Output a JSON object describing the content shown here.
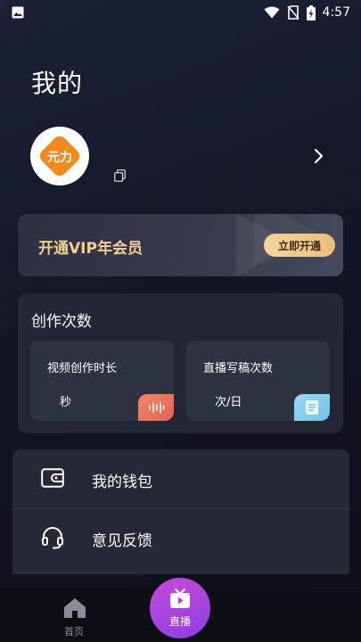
{
  "status_bar": {
    "time": "4:57"
  },
  "page": {
    "title": "我的"
  },
  "profile": {
    "avatar_text": "元力"
  },
  "vip": {
    "title": "开通VIP年会员",
    "button": "立即开通"
  },
  "creation": {
    "title": "创作次数",
    "cards": [
      {
        "label": "视频创作时长",
        "unit": "秒",
        "icon": "waveform-icon"
      },
      {
        "label": "直播写稿次数",
        "unit": "次/日",
        "icon": "document-icon"
      }
    ]
  },
  "menu": {
    "items": [
      {
        "label": "我的钱包",
        "icon": "wallet-icon"
      },
      {
        "label": "意见反馈",
        "icon": "headset-icon"
      }
    ]
  },
  "nav": {
    "home": "首页",
    "live": "直播"
  },
  "colors": {
    "accent_gold": "#f0cf92",
    "live_purple": "#b347dc"
  }
}
